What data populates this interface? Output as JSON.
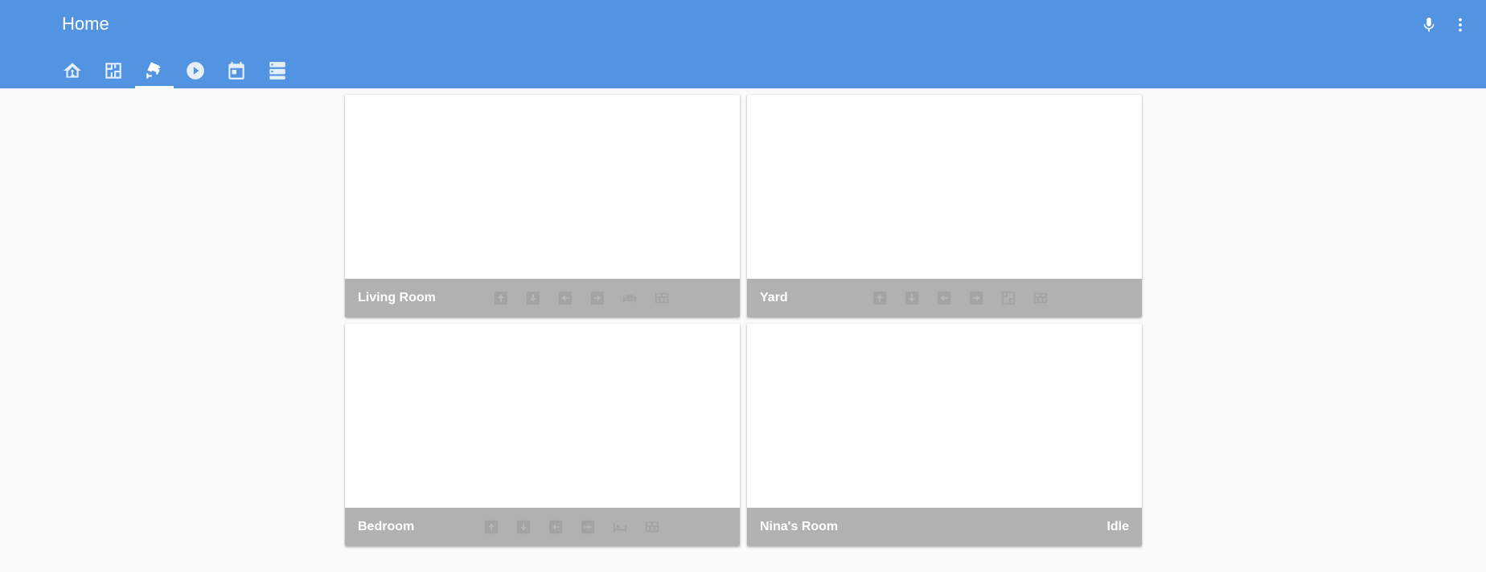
{
  "header": {
    "title": "Home",
    "background_color": "#5294e2",
    "icons": [
      "microphone-icon",
      "more-vert-icon"
    ]
  },
  "tabs": [
    {
      "icon": "home-assistant-icon",
      "active": false
    },
    {
      "icon": "floor-plan-icon",
      "active": false
    },
    {
      "icon": "cctv-icon",
      "active": true
    },
    {
      "icon": "play-circle-icon",
      "active": false
    },
    {
      "icon": "calendar-icon",
      "active": false
    },
    {
      "icon": "server-icon",
      "active": false
    }
  ],
  "cards": [
    {
      "name": "Living Room",
      "state": "",
      "controls": [
        "arrow-up-icon",
        "arrow-down-icon",
        "arrow-left-icon",
        "arrow-right-icon",
        "sofa-icon",
        "wall-icon"
      ]
    },
    {
      "name": "Yard",
      "state": "",
      "controls": [
        "arrow-up-icon",
        "arrow-down-icon",
        "arrow-left-icon",
        "arrow-right-icon",
        "floor-plan-icon",
        "wall-icon"
      ]
    },
    {
      "name": "Bedroom",
      "state": "",
      "controls": [
        "arrow-up-icon",
        "arrow-down-icon",
        "arrow-left-icon",
        "arrow-right-icon",
        "bed-icon",
        "wall-icon"
      ]
    },
    {
      "name": "Nina's Room",
      "state": "Idle",
      "controls": []
    }
  ],
  "colors": {
    "card_footer": "#b1b1b1",
    "page_background": "#fafafa"
  }
}
